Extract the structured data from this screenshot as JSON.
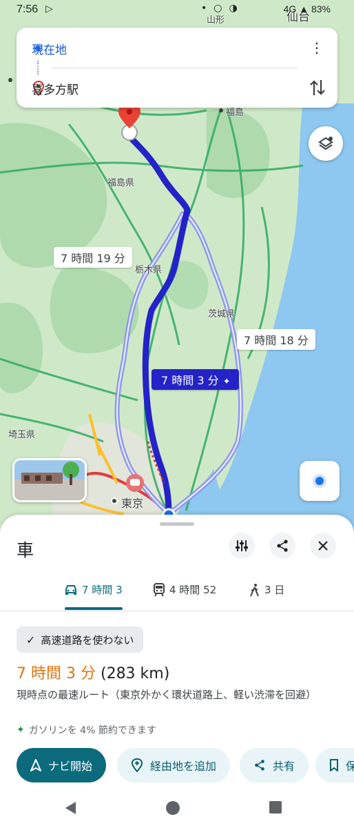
{
  "status_bar": {
    "time": "7:56",
    "battery": "83%",
    "network": "4G"
  },
  "route_card": {
    "origin": "現在地",
    "destination": "喜多方駅"
  },
  "map": {
    "labels": {
      "yamagata": "山形",
      "sendai": "仙台",
      "fukushima_city": "福島",
      "fukushima_pref": "福島県",
      "tochigi_pref": "栃木県",
      "ibaraki_pref": "茨城県",
      "saitama_pref": "埼玉県",
      "tokyo": "東京"
    },
    "route_bubbles": {
      "alt_west": "7 時間 19 分",
      "alt_east": "7 時間 18 分",
      "primary": "7 時間 3 分"
    },
    "colors": {
      "primary_route": "#2323c8",
      "alt_route": "#8e97f0",
      "land": "#cfe9c8",
      "forest": "#9fd3a0",
      "sea": "#8ec7ef",
      "highway": "#2eaa5f"
    }
  },
  "sheet": {
    "title": "車",
    "tabs": [
      {
        "icon": "car-icon",
        "label": "7 時間 3"
      },
      {
        "icon": "train-icon",
        "label": "4 時間 52"
      },
      {
        "icon": "walk-icon",
        "label": "3 日"
      }
    ],
    "chip_label": "高速道路を使わない",
    "eta_duration": "7 時間 3 分",
    "eta_distance": "(283 km)",
    "description": "現時点の最速ルート（東京外かく環状道路上、軽い渋滞を回避）",
    "fuel_note": "ガソリンを 4% 節約できます",
    "actions": {
      "navigate": "ナビ開始",
      "add_stop": "経由地を追加",
      "share": "共有",
      "save": "保"
    }
  }
}
